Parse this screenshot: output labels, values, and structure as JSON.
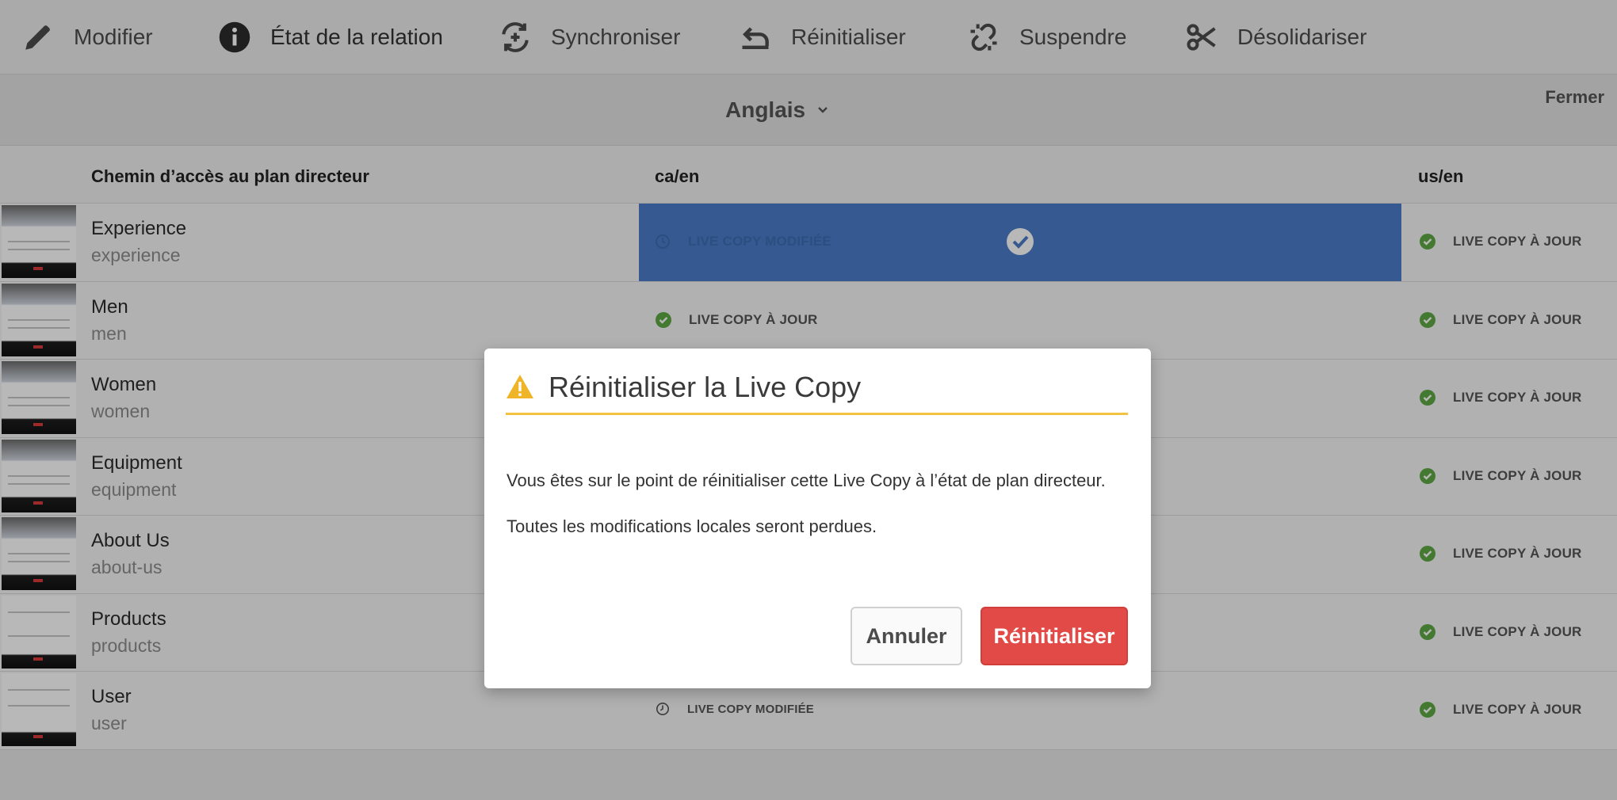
{
  "toolbar": {
    "items": [
      {
        "label": "Modifier",
        "icon": "pencil-icon"
      },
      {
        "label": "État de la relation",
        "icon": "info-icon"
      },
      {
        "label": "Synchroniser",
        "icon": "sync-icon"
      },
      {
        "label": "Réinitialiser",
        "icon": "undo-icon"
      },
      {
        "label": "Suspendre",
        "icon": "broken-link-icon"
      },
      {
        "label": "Désolidariser",
        "icon": "scissors-icon"
      }
    ]
  },
  "langbar": {
    "selected_language": "Anglais",
    "close_label": "Fermer"
  },
  "table": {
    "headers": [
      "Chemin d’accès au plan directeur",
      "ca/en",
      "us/en"
    ],
    "rows": [
      {
        "title": "Experience",
        "name": "experience",
        "ca_en": "LIVE COPY MODIFIÉE",
        "us_en": "LIVE COPY À JOUR"
      },
      {
        "title": "Men",
        "name": "men",
        "ca_en": "LIVE COPY À JOUR",
        "us_en": "LIVE COPY À JOUR"
      },
      {
        "title": "Women",
        "name": "women",
        "ca_en": "",
        "us_en": "LIVE COPY À JOUR"
      },
      {
        "title": "Equipment",
        "name": "equipment",
        "ca_en": "",
        "us_en": "LIVE COPY À JOUR"
      },
      {
        "title": "About Us",
        "name": "about-us",
        "ca_en": "",
        "us_en": "LIVE COPY À JOUR"
      },
      {
        "title": "Products",
        "name": "products",
        "ca_en": "",
        "us_en": "LIVE COPY À JOUR"
      },
      {
        "title": "User",
        "name": "user",
        "ca_en": "LIVE COPY MODIFIÉE",
        "us_en": "LIVE COPY À JOUR"
      }
    ]
  },
  "modal": {
    "title": "Réinitialiser la Live Copy",
    "message1": "Vous êtes sur le point de réinitialiser cette Live Copy à l’état de plan directeur.",
    "message2": "Toutes les modifications locales seront perdues.",
    "cancel_label": "Annuler",
    "confirm_label": "Réinitialiser"
  },
  "colors": {
    "accent_selected": "#4a7cc8",
    "status_ok": "#5ea843",
    "warning": "#f3c241",
    "danger": "#e14a46"
  }
}
